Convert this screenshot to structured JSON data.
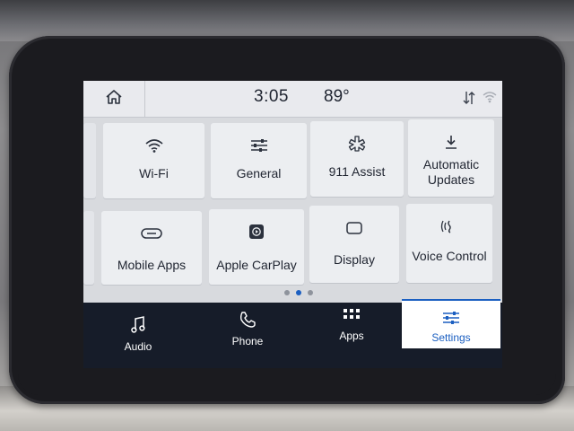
{
  "status": {
    "time": "3:05",
    "temperature": "89°"
  },
  "icons": {
    "home": "home-icon",
    "data": "data-arrows-icon",
    "wifi_status": "wifi-status-icon"
  },
  "tiles": [
    {
      "label": "Wi-Fi",
      "icon": "wifi-icon"
    },
    {
      "label": "General",
      "icon": "sliders-icon"
    },
    {
      "label": "911 Assist",
      "icon": "assist-icon"
    },
    {
      "label": "Automatic Updates",
      "icon": "download-icon"
    },
    {
      "label": "Mobile Apps",
      "icon": "mobile-apps-icon"
    },
    {
      "label": "Apple CarPlay",
      "icon": "carplay-icon"
    },
    {
      "label": "Display",
      "icon": "display-icon"
    },
    {
      "label": "Voice Control",
      "icon": "voice-icon"
    }
  ],
  "pagination": {
    "count": 3,
    "active_index": 1
  },
  "nav": [
    {
      "label": "Audio",
      "icon": "music-note-icon"
    },
    {
      "label": "Phone",
      "icon": "phone-icon"
    },
    {
      "label": "Apps",
      "icon": "apps-grid-icon"
    },
    {
      "label": "Settings",
      "icon": "settings-sliders-icon",
      "active": true
    }
  ],
  "colors": {
    "accent": "#1b5fc1",
    "nav_bg": "#161c29",
    "tile_bg": "#eceef1"
  }
}
